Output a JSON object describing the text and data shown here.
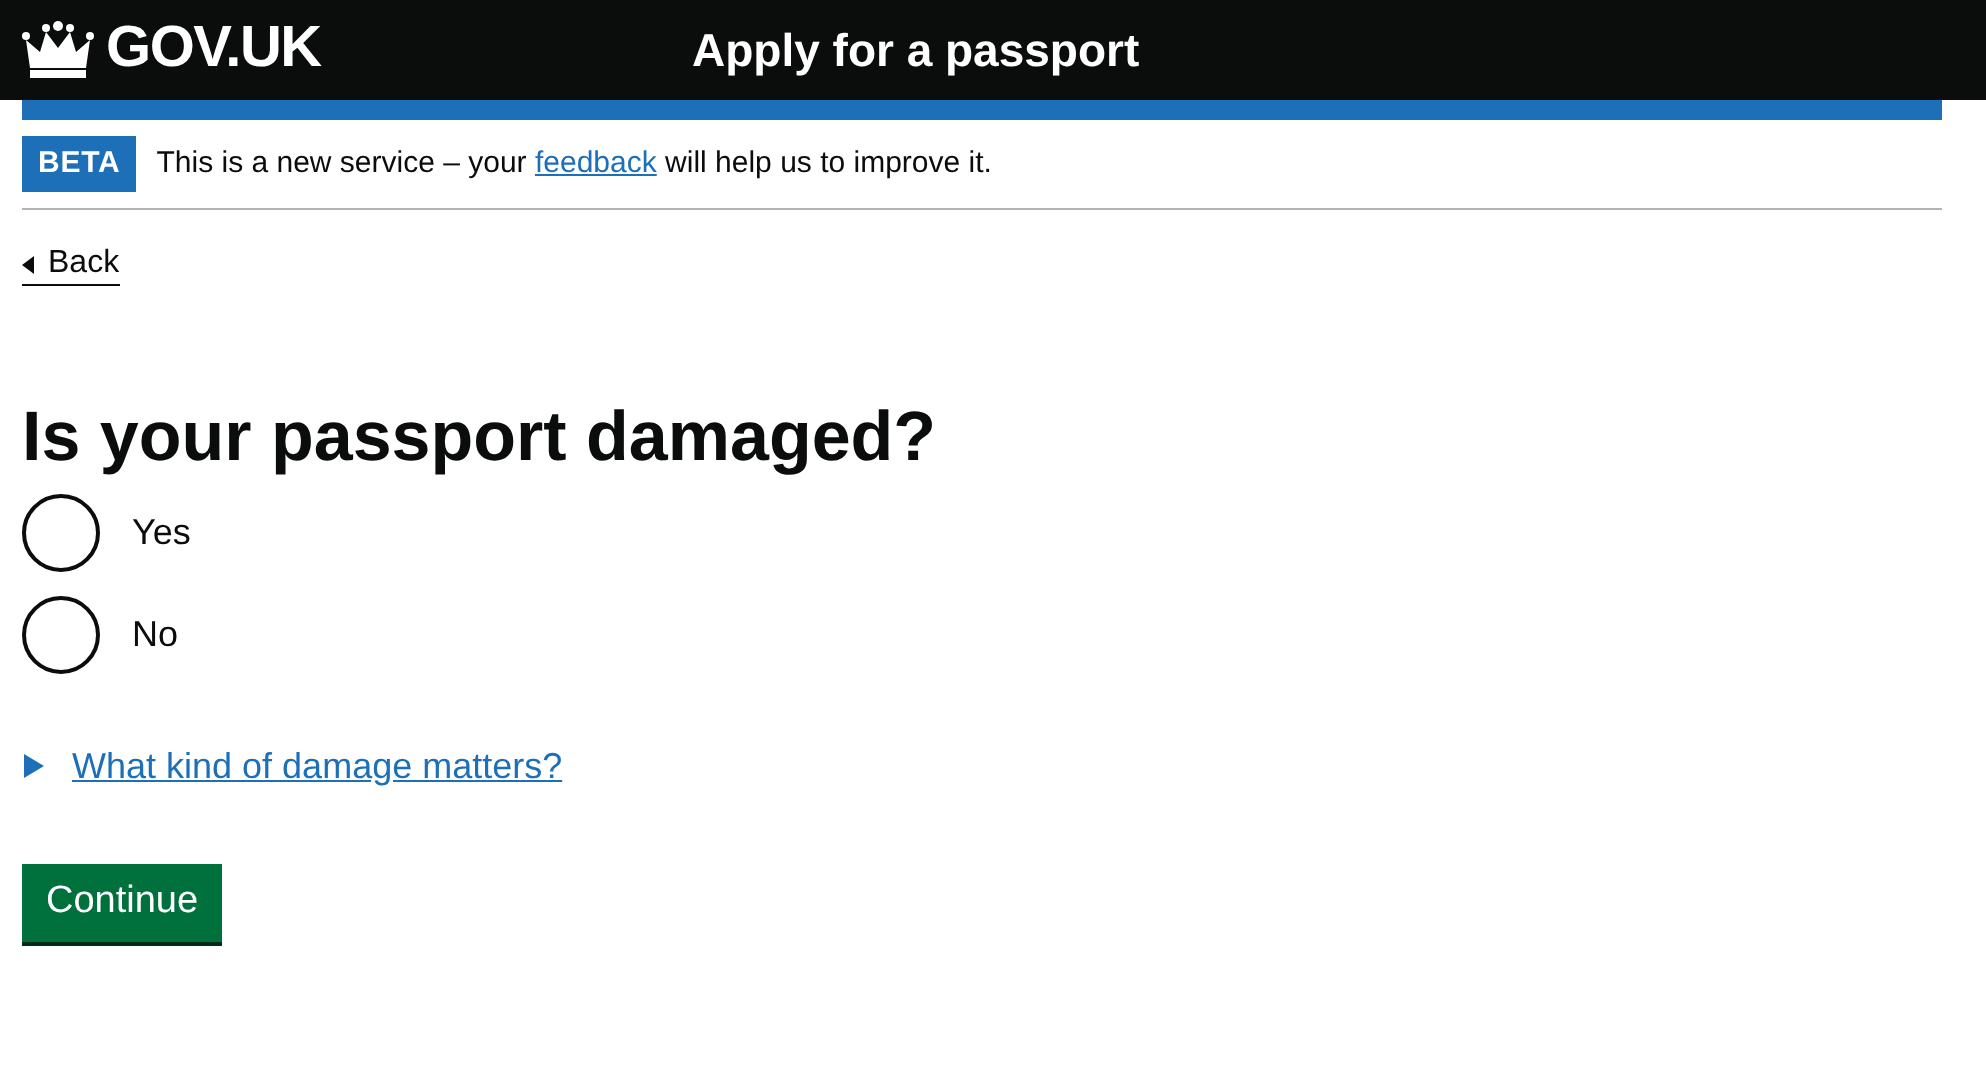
{
  "header": {
    "logo": "GOV.UK",
    "service_name": "Apply for a passport"
  },
  "phase_banner": {
    "tag": "BETA",
    "text_before": "This is a new service – your ",
    "link": "feedback",
    "text_after": " will help us to improve it."
  },
  "back_link": "Back",
  "question": "Is your passport damaged?",
  "options": [
    {
      "label": "Yes",
      "selected": false
    },
    {
      "label": "No",
      "selected": false
    }
  ],
  "details": {
    "summary": "What kind of damage matters?",
    "expanded": false
  },
  "button": "Continue"
}
